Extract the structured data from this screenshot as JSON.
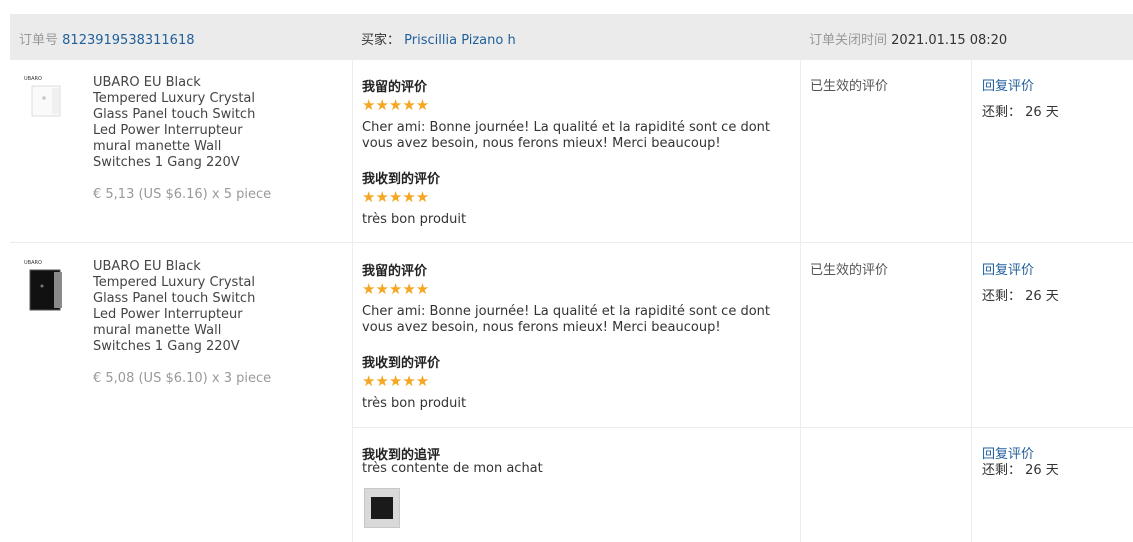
{
  "header": {
    "order_label": "订单号",
    "order_number": "8123919538311618",
    "buyer_label": "买家：",
    "buyer_name": "Priscillia Pizano h",
    "closed_label": "订单关闭时间",
    "closed_time": "2021.01.15 08:20"
  },
  "items": [
    {
      "brand_mark": "UBARO",
      "title": "UBARO EU Black Tempered Luxury Crystal Glass Panel touch Switch Led Power Interrupteur mural manette Wall Switches 1 Gang 220V",
      "price": "€ 5,13 (US $6.16) x 5 piece",
      "left_review_label": "我留的评价",
      "left_review_stars": "★★★★★",
      "left_review_text": "Cher ami: Bonne journée! La qualité et la rapidité sont ce dont vous avez besoin, nous ferons mieux! Merci beaucoup!",
      "received_review_label": "我收到的评价",
      "received_review_stars": "★★★★★",
      "received_review_text": "très bon produit",
      "status": "已生效的评价",
      "reply_label": "回复评价",
      "remaining": "还剩： 26 天"
    },
    {
      "brand_mark": "UBARO",
      "title": "UBARO EU Black Tempered Luxury Crystal Glass Panel touch Switch Led Power Interrupteur mural manette Wall Switches 1 Gang 220V",
      "price": "€ 5,08 (US $6.10) x 3 piece",
      "left_review_label": "我留的评价",
      "left_review_stars": "★★★★★",
      "left_review_text": "Cher ami: Bonne journée! La qualité et la rapidité sont ce dont vous avez besoin, nous ferons mieux! Merci beaucoup!",
      "received_review_label": "我收到的评价",
      "received_review_stars": "★★★★★",
      "received_review_text": "très bon produit",
      "status": "已生效的评价",
      "reply_label": "回复评价",
      "remaining": "还剩： 26 天"
    }
  ],
  "followup": {
    "label": "我收到的追评",
    "text": "très contente de mon achat",
    "reply_label": "回复评价",
    "remaining": "还剩： 26 天"
  },
  "colors": {
    "link": "#1f5f9b",
    "star": "#f5a623",
    "header_bg": "#ebebeb"
  }
}
